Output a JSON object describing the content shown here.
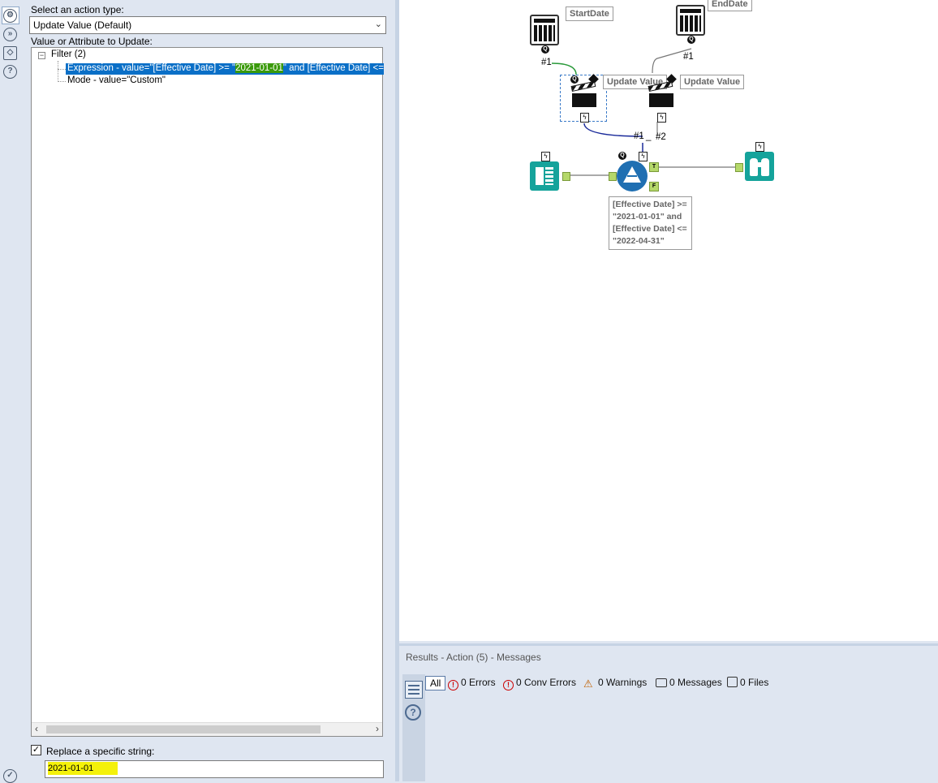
{
  "config": {
    "action_type_label": "Select an action type:",
    "action_type_value": "Update Value (Default)",
    "value_attr_label": "Value or Attribute to Update:",
    "tree": {
      "filter_node": "Filter (2)",
      "expression_prefix": "Expression - value=\"[Effective Date] >= \"",
      "expression_highlight": "2021-01-01",
      "expression_suffix": "\" and [Effective Date] <=",
      "mode_node": "Mode - value=\"Custom\""
    },
    "replace_label": "Replace a specific string:",
    "replace_checked": "✓",
    "replace_value": "2021-01-01"
  },
  "canvas": {
    "start_date_label": "StartDate",
    "end_date_label": "EndDate",
    "update_value_1": "Update Value",
    "update_value_2": "Update Value",
    "anchor_1a": "#1",
    "anchor_1b": "#1",
    "anchor_1c": "#1",
    "anchor_2": "#2",
    "filter_annotation": "[Effective Date] >= \"2021-01-01\" and [Effective Date] <= \"2022-04-31\"",
    "t_label": "T",
    "f_label": "F"
  },
  "results": {
    "title": "Results - Action (5) - Messages",
    "tab_all": "All",
    "errors": "0 Errors",
    "conv_errors": "0 Conv Errors",
    "warnings": "0 Warnings",
    "messages": "0 Messages",
    "files": "0 Files"
  },
  "colors": {
    "selection_blue": "#0a6fc7",
    "highlight_green": "#3a9a0a",
    "highlight_yellow": "#f4f10a",
    "tool_teal": "#15a39b",
    "filter_blue": "#1f6fb2",
    "anchor_green": "#b5d86a"
  }
}
